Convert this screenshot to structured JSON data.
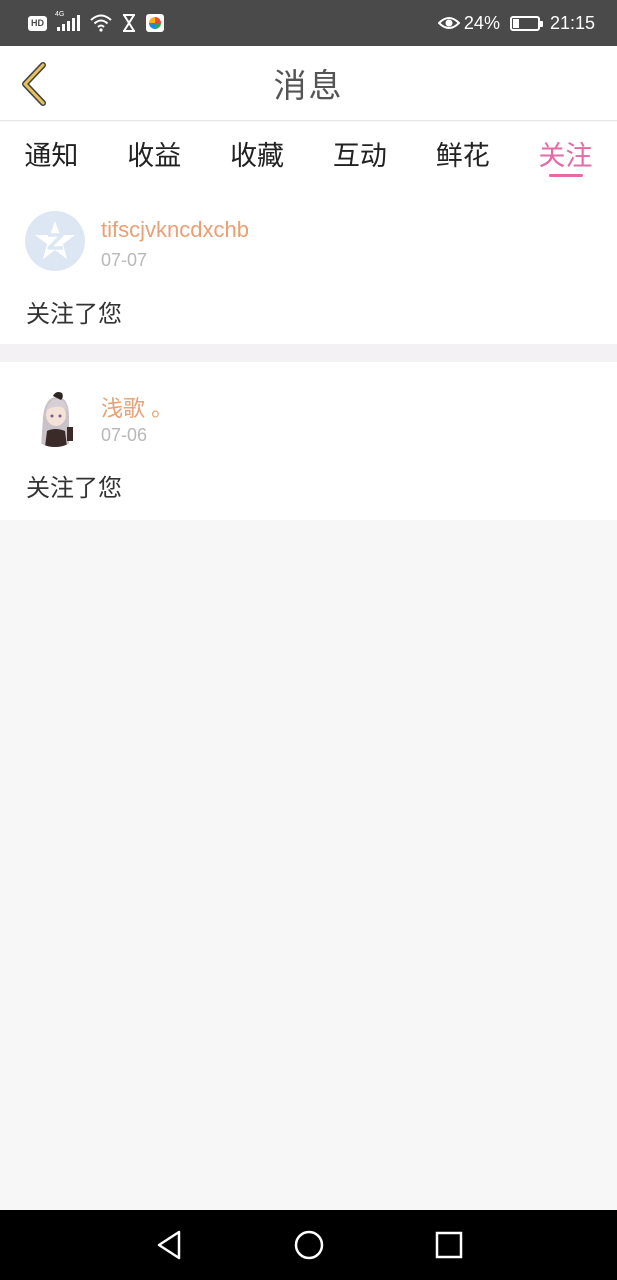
{
  "status_bar": {
    "hd_label": "HD",
    "network_label": "4G",
    "battery_percent": "24%",
    "battery_level": 0.24,
    "time": "21:15",
    "icons": [
      "hd-icon",
      "signal-icon",
      "wifi-icon",
      "hourglass-icon",
      "app-notification-icon",
      "eye-icon",
      "battery-icon"
    ]
  },
  "header": {
    "title": "消息",
    "back_icon": "chevron-left-icon",
    "back_icon_color": "#e8c25a"
  },
  "tabs": [
    {
      "label": "通知",
      "active": false
    },
    {
      "label": "收益",
      "active": false
    },
    {
      "label": "收藏",
      "active": false
    },
    {
      "label": "互动",
      "active": false
    },
    {
      "label": "鲜花",
      "active": false
    },
    {
      "label": "关注",
      "active": true
    }
  ],
  "colors": {
    "accent": "#e56aa6",
    "username": "#e8a074",
    "date": "#b8b8b8"
  },
  "items": [
    {
      "username": "tifscjvkncdxchb",
      "date": "07-07",
      "message": "关注了您",
      "avatar": "default-qq-avatar"
    },
    {
      "username": "浅歌 。",
      "date": "07-06",
      "message": "关注了您",
      "avatar": "anime-girl-avatar"
    }
  ],
  "nav_bar": {
    "icons": [
      "back-triangle-icon",
      "home-circle-icon",
      "recents-square-icon"
    ]
  }
}
